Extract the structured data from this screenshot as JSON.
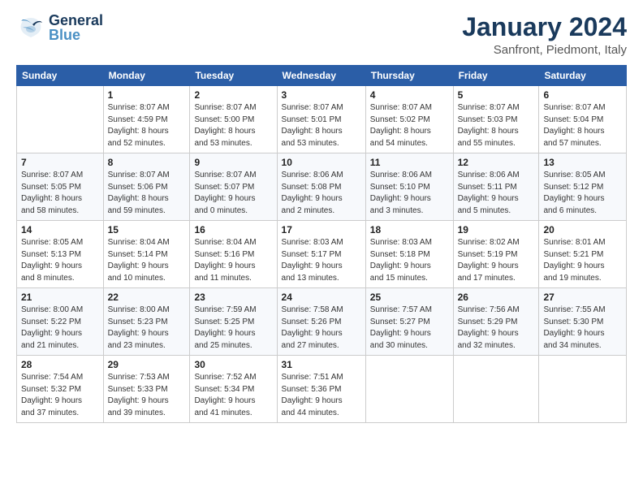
{
  "header": {
    "logo_general": "General",
    "logo_blue": "Blue",
    "main_title": "January 2024",
    "subtitle": "Sanfront, Piedmont, Italy"
  },
  "calendar": {
    "days_of_week": [
      "Sunday",
      "Monday",
      "Tuesday",
      "Wednesday",
      "Thursday",
      "Friday",
      "Saturday"
    ],
    "weeks": [
      [
        {
          "day": "",
          "info": ""
        },
        {
          "day": "1",
          "info": "Sunrise: 8:07 AM\nSunset: 4:59 PM\nDaylight: 8 hours\nand 52 minutes."
        },
        {
          "day": "2",
          "info": "Sunrise: 8:07 AM\nSunset: 5:00 PM\nDaylight: 8 hours\nand 53 minutes."
        },
        {
          "day": "3",
          "info": "Sunrise: 8:07 AM\nSunset: 5:01 PM\nDaylight: 8 hours\nand 53 minutes."
        },
        {
          "day": "4",
          "info": "Sunrise: 8:07 AM\nSunset: 5:02 PM\nDaylight: 8 hours\nand 54 minutes."
        },
        {
          "day": "5",
          "info": "Sunrise: 8:07 AM\nSunset: 5:03 PM\nDaylight: 8 hours\nand 55 minutes."
        },
        {
          "day": "6",
          "info": "Sunrise: 8:07 AM\nSunset: 5:04 PM\nDaylight: 8 hours\nand 57 minutes."
        }
      ],
      [
        {
          "day": "7",
          "info": "Sunrise: 8:07 AM\nSunset: 5:05 PM\nDaylight: 8 hours\nand 58 minutes."
        },
        {
          "day": "8",
          "info": "Sunrise: 8:07 AM\nSunset: 5:06 PM\nDaylight: 8 hours\nand 59 minutes."
        },
        {
          "day": "9",
          "info": "Sunrise: 8:07 AM\nSunset: 5:07 PM\nDaylight: 9 hours\nand 0 minutes."
        },
        {
          "day": "10",
          "info": "Sunrise: 8:06 AM\nSunset: 5:08 PM\nDaylight: 9 hours\nand 2 minutes."
        },
        {
          "day": "11",
          "info": "Sunrise: 8:06 AM\nSunset: 5:10 PM\nDaylight: 9 hours\nand 3 minutes."
        },
        {
          "day": "12",
          "info": "Sunrise: 8:06 AM\nSunset: 5:11 PM\nDaylight: 9 hours\nand 5 minutes."
        },
        {
          "day": "13",
          "info": "Sunrise: 8:05 AM\nSunset: 5:12 PM\nDaylight: 9 hours\nand 6 minutes."
        }
      ],
      [
        {
          "day": "14",
          "info": "Sunrise: 8:05 AM\nSunset: 5:13 PM\nDaylight: 9 hours\nand 8 minutes."
        },
        {
          "day": "15",
          "info": "Sunrise: 8:04 AM\nSunset: 5:14 PM\nDaylight: 9 hours\nand 10 minutes."
        },
        {
          "day": "16",
          "info": "Sunrise: 8:04 AM\nSunset: 5:16 PM\nDaylight: 9 hours\nand 11 minutes."
        },
        {
          "day": "17",
          "info": "Sunrise: 8:03 AM\nSunset: 5:17 PM\nDaylight: 9 hours\nand 13 minutes."
        },
        {
          "day": "18",
          "info": "Sunrise: 8:03 AM\nSunset: 5:18 PM\nDaylight: 9 hours\nand 15 minutes."
        },
        {
          "day": "19",
          "info": "Sunrise: 8:02 AM\nSunset: 5:19 PM\nDaylight: 9 hours\nand 17 minutes."
        },
        {
          "day": "20",
          "info": "Sunrise: 8:01 AM\nSunset: 5:21 PM\nDaylight: 9 hours\nand 19 minutes."
        }
      ],
      [
        {
          "day": "21",
          "info": "Sunrise: 8:00 AM\nSunset: 5:22 PM\nDaylight: 9 hours\nand 21 minutes."
        },
        {
          "day": "22",
          "info": "Sunrise: 8:00 AM\nSunset: 5:23 PM\nDaylight: 9 hours\nand 23 minutes."
        },
        {
          "day": "23",
          "info": "Sunrise: 7:59 AM\nSunset: 5:25 PM\nDaylight: 9 hours\nand 25 minutes."
        },
        {
          "day": "24",
          "info": "Sunrise: 7:58 AM\nSunset: 5:26 PM\nDaylight: 9 hours\nand 27 minutes."
        },
        {
          "day": "25",
          "info": "Sunrise: 7:57 AM\nSunset: 5:27 PM\nDaylight: 9 hours\nand 30 minutes."
        },
        {
          "day": "26",
          "info": "Sunrise: 7:56 AM\nSunset: 5:29 PM\nDaylight: 9 hours\nand 32 minutes."
        },
        {
          "day": "27",
          "info": "Sunrise: 7:55 AM\nSunset: 5:30 PM\nDaylight: 9 hours\nand 34 minutes."
        }
      ],
      [
        {
          "day": "28",
          "info": "Sunrise: 7:54 AM\nSunset: 5:32 PM\nDaylight: 9 hours\nand 37 minutes."
        },
        {
          "day": "29",
          "info": "Sunrise: 7:53 AM\nSunset: 5:33 PM\nDaylight: 9 hours\nand 39 minutes."
        },
        {
          "day": "30",
          "info": "Sunrise: 7:52 AM\nSunset: 5:34 PM\nDaylight: 9 hours\nand 41 minutes."
        },
        {
          "day": "31",
          "info": "Sunrise: 7:51 AM\nSunset: 5:36 PM\nDaylight: 9 hours\nand 44 minutes."
        },
        {
          "day": "",
          "info": ""
        },
        {
          "day": "",
          "info": ""
        },
        {
          "day": "",
          "info": ""
        }
      ]
    ]
  }
}
